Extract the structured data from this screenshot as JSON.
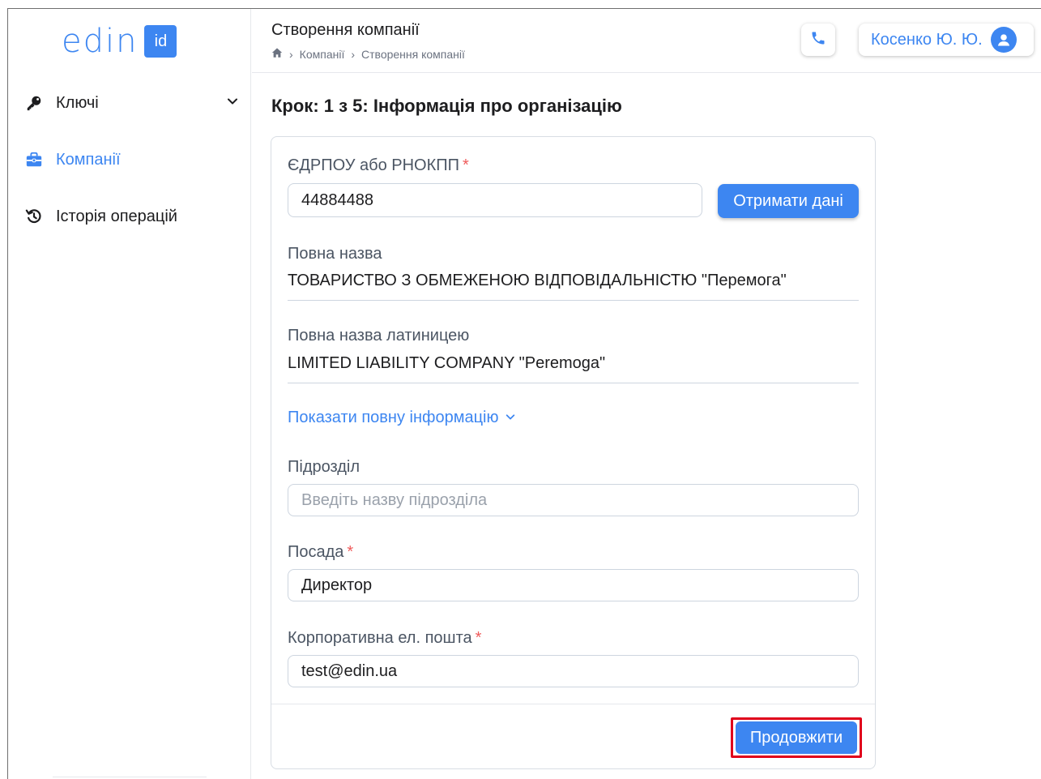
{
  "app": {
    "logo_text": "edin",
    "logo_badge": "id"
  },
  "sidebar": {
    "items": [
      {
        "label": "Ключі",
        "icon": "key-icon",
        "active": false,
        "expandable": true
      },
      {
        "label": "Компанії",
        "icon": "briefcase-icon",
        "active": true
      },
      {
        "label": "Історія операцій",
        "icon": "history-icon",
        "active": false
      }
    ]
  },
  "header": {
    "title": "Створення компанії",
    "breadcrumb": [
      "Компанії",
      "Створення компанії"
    ],
    "user_name": "Косенко Ю. Ю."
  },
  "main": {
    "step_title": "Крок: 1 з 5: Інформація про організацію",
    "fields": {
      "edrpou": {
        "label": "ЄДРПОУ або РНОКПП",
        "required_mark": "*",
        "value": "44884488"
      },
      "get_data_button": "Отримати дані",
      "full_name": {
        "label": "Повна назва",
        "value": "ТОВАРИСТВО З ОБМЕЖЕНОЮ ВІДПОВІДАЛЬНІСТЮ \"Перемога\""
      },
      "full_name_latin": {
        "label": "Повна назва латиницею",
        "value": "LIMITED LIABILITY COMPANY \"Peremoga\""
      },
      "show_more": "Показати повну інформацію",
      "department": {
        "label": "Підрозділ",
        "placeholder": "Введіть назву підрозділа",
        "value": ""
      },
      "position": {
        "label": "Посада",
        "required_mark": "*",
        "value": "Директор"
      },
      "email": {
        "label": "Корпоративна ел. пошта",
        "required_mark": "*",
        "value": "test@edin.ua"
      }
    },
    "continue_button": "Продовжити"
  },
  "colors": {
    "accent": "#3d86f1",
    "required": "#ef5b5b",
    "highlight": "#e0001b"
  }
}
